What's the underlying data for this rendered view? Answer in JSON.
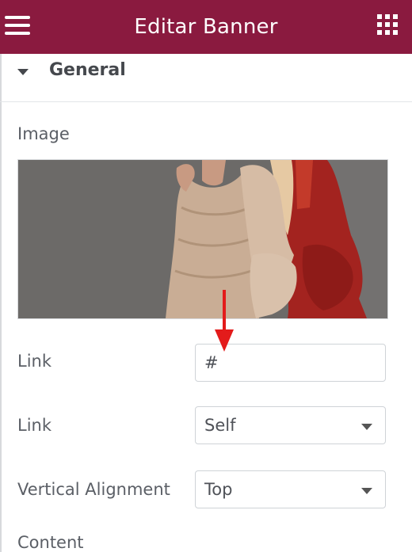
{
  "header": {
    "title": "Editar Banner",
    "background": "#8a1a3f",
    "menu_icon": "hamburger-menu-icon",
    "apps_icon": "grid-apps-icon"
  },
  "section": {
    "title": "General",
    "expanded": true
  },
  "image_control": {
    "label": "Image"
  },
  "link_field": {
    "label": "Link",
    "value": "#"
  },
  "link_target": {
    "label": "Link",
    "selected": "Self"
  },
  "vertical_alignment": {
    "label": "Vertical Alignment",
    "selected": "Top"
  },
  "content": {
    "label": "Content"
  },
  "annotation": {
    "color": "#e31b1b"
  }
}
